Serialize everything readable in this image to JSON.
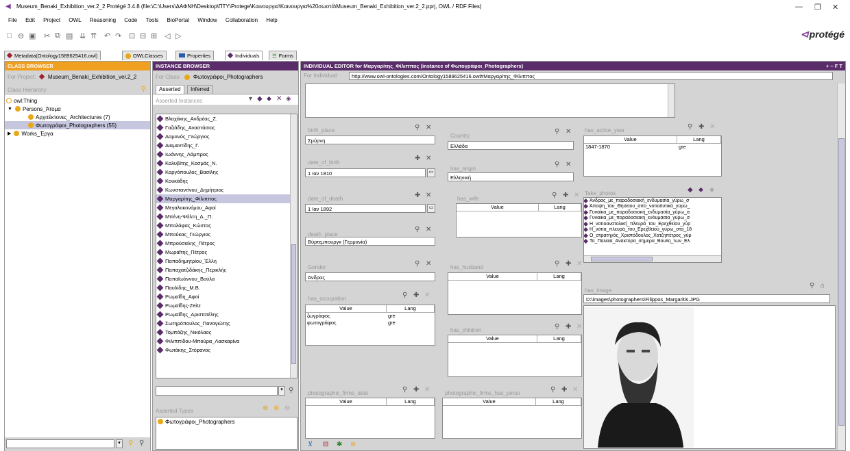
{
  "window": {
    "title": "Museum_Benaki_Exhibition_ver.2_2  Protégé 3.4.8   (file:\\C:\\Users\\ΔΑΦΝΗ\\Desktop\\ΠΤΥ\\Protege\\Καινουργια\\Καινουργια%20σωστά\\Museum_Benaki_Exhibition_ver.2_2.pprj, OWL / RDF Files)"
  },
  "menu": [
    "File",
    "Edit",
    "Project",
    "OWL",
    "Reasoning",
    "Code",
    "Tools",
    "BioPortal",
    "Window",
    "Collaboration",
    "Help"
  ],
  "logo": "protégé",
  "tabs": [
    "Metadata(Ontology1589625416.owl)",
    "OWLClasses",
    "Properties",
    "Individuals",
    "Forms"
  ],
  "class_browser": {
    "header": "CLASS BROWSER",
    "project_label": "For Project:",
    "project": "Museum_Benaki_Exhibition_ver.2_2",
    "hierarchy_label": "Class Hierarchy",
    "tree": [
      {
        "label": "owl:Thing",
        "depth": 0
      },
      {
        "label": "Persons_Άτομα",
        "depth": 1
      },
      {
        "label": "Αρχιτέκτονες_Architectures  (7)",
        "depth": 2
      },
      {
        "label": "Φωτογράφοι_Photographers  (55)",
        "depth": 2
      },
      {
        "label": "Works_Έργα",
        "depth": 1
      }
    ]
  },
  "instance_browser": {
    "header": "INSTANCE BROWSER",
    "class_label": "For Class:",
    "class_name": "Φωτογράφοι_Photographers",
    "tab_asserted": "Asserted",
    "tab_inferred": "Inferred",
    "instances_label": "Asserted Instances",
    "instances": [
      "Βλαχάκης_Ανδρέας_Ζ.",
      "Γαζιάδης_Αναστάσιος",
      "Δαμανός_Γεώργιος",
      "Διαμαντίδης_Γ.",
      "Ιωάννης_Λάμπρος",
      "Καλυβίτης_Κοσμάς_Ν.",
      "Καργόπουλος_Βασίλης",
      "Κουκάδης",
      "Κωνσταντίνου_Δημήτριος",
      "Μαργαρίτης_Φίλιππος",
      "Μεγαλοκονόμου_Αφοί",
      "Μπένη-Ψάλτη_Δ._Π.",
      "Μπαλάφας_Κώστας",
      "Μπούκας_Γεώργιος",
      "Μπρούσαλης_Πέτρος",
      "Μωραΐτης_Πέτρος",
      "Παπαδημητρίου_Έλλη",
      "Παπαχατζιδάκης_Περικλής",
      "Παπαϊωάννου_Βούλα",
      "Παυλίδης_Μ.Β.",
      "Ρωμαΐδη_Αφοί",
      "Ρωμαΐδης-Zeitz",
      "Ρωμαΐδης_Αριστοτέλης",
      "Σωτηρόπουλος_Παναγιώτης",
      "Τομπάζης_Νικόλαος",
      "Φιλιππίδου-Μπούρα_Λασκαρίνα",
      "Φωτάκης_Στέφανος"
    ],
    "selected": "Μαργαρίτης_Φίλιππος",
    "types_label": "Asserted Types",
    "types": [
      "Φωτογράφοι_Photographers"
    ]
  },
  "editor": {
    "header": "INDIVIDUAL EDITOR for Μαργαρίτης_Φίλιππος   (instance of Φωτογράφοι_Photographers)",
    "header_controls": "+ − F T",
    "for_individual_label": "For Individual:",
    "uri": "http://www.owl-ontologies.com/Ontology1589625416.owl#Μαργαρίτης_Φίλιππος",
    "birth_place": {
      "label": "birth_place",
      "value": "Σμύρνη"
    },
    "date_of_birth": {
      "label": "date_of_birth",
      "value": "1 Ιαν 1810"
    },
    "date_of_death": {
      "label": "date_of_death",
      "value": "1 Ιαν 1892"
    },
    "death_place": {
      "label": "death_place",
      "value": "Βύρτεμπουργκ (Γερμανία)"
    },
    "gender": {
      "label": "Gender",
      "value": "Άνδρας"
    },
    "country": {
      "label": "Country",
      "value": "Ελλάδα"
    },
    "has_origin": {
      "label": "has_origin",
      "value": "Ελληνική"
    },
    "has_wife": {
      "label": "has_wife"
    },
    "has_husband": {
      "label": "has_husband"
    },
    "has_children": {
      "label": "has_children"
    },
    "has_occupation": {
      "label": "has_occupation",
      "rows": [
        {
          "value": "ζωγράφος",
          "lang": "gre"
        },
        {
          "value": "φωτογράφος",
          "lang": "gre"
        }
      ]
    },
    "has_active_year": {
      "label": "has_active_year",
      "rows": [
        {
          "value": "1847-1870",
          "lang": "gre"
        }
      ]
    },
    "col_value": "Value",
    "col_lang": "Lang",
    "take_photos": {
      "label": "Take_photos",
      "items": [
        "Άνδρας_με_παραδοσιακή_ενδυμασία_γύρω_σ",
        "Άποψη_του_Θησείου_από_νοτιοδυτικά_γύρω_",
        "Γυναίκα_με_παραδοσιακή_ενδυμασία_γύρω_σ",
        "Γυναίκα_με_παραδοσιακή_ενδυμασία_γύρω_σ",
        "Η_νοτιοανατολική_πλευρά_του_Ερεχθείου_γύρ",
        "Η_νότια_πλευρά_του_Ερεχθείου_γύρω_στα_18",
        "Ο_στρατηγός_Χριστόδουλος_Χατζηπέτρος_γύρ",
        "Τα_Παλαιά_Ανάκτορα_σήμερα_Βουλή_των_Ελ"
      ]
    },
    "has_image": {
      "label": "has_image",
      "path": "D:\\images\\photographers\\Filippos_Margaritis.JPG"
    },
    "photographic_firms_date": {
      "label": "photographic_firms_date"
    },
    "photographic_firms_has_person": {
      "label": "photographic_firms_has_perso"
    }
  },
  "colors": {
    "orange": "#f0a020",
    "purple": "#5a2d6a",
    "selection": "#c6c6df"
  }
}
